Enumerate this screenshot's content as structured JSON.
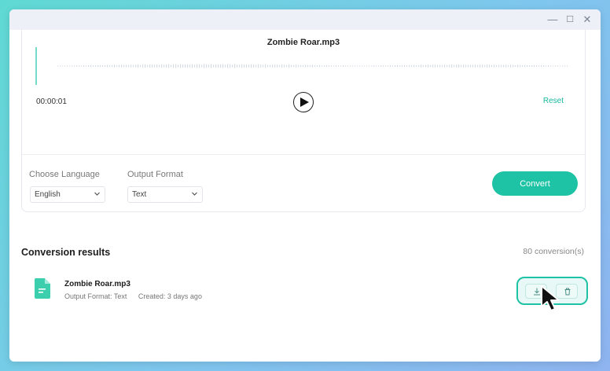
{
  "window": {
    "controls": {
      "minimize": "—",
      "maximize": "☐",
      "close": "✕"
    }
  },
  "player": {
    "file_name": "Zombie Roar.mp3",
    "current_time": "00:00:01",
    "reset_label": "Reset",
    "progress": 0.0
  },
  "options": {
    "language_label": "Choose Language",
    "language_value": "English",
    "format_label": "Output Format",
    "format_value": "Text",
    "convert_label": "Convert"
  },
  "results": {
    "title": "Conversion results",
    "count": "80 conversion(s)",
    "items": [
      {
        "name": "Zombie Roar.mp3",
        "format": "Output Format: Text",
        "created": "Created: 3 days ago",
        "icon": "document-icon"
      }
    ]
  },
  "colors": {
    "accent": "#1ec2a4",
    "accent_light": "#e8f8f6",
    "titlebar": "#eef0f8",
    "text_dark": "#1c1c1c"
  },
  "icons": {
    "play": "play-icon",
    "download": "download-icon",
    "delete": "trash-icon",
    "dropdown": "chevron-down-icon",
    "cursor": "mouse-pointer-icon"
  }
}
